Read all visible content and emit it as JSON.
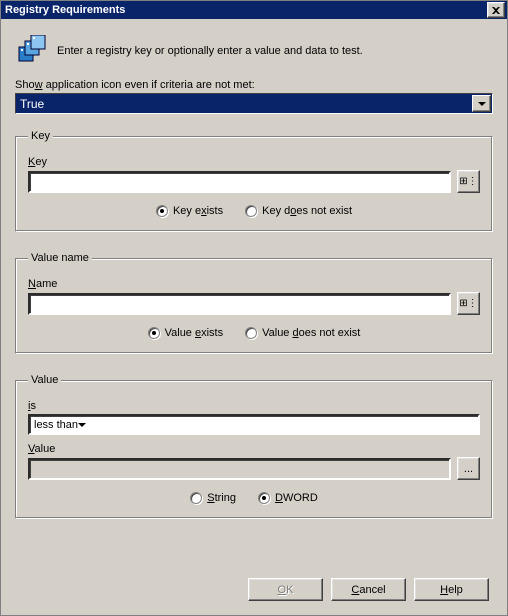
{
  "window": {
    "title": "Registry Requirements"
  },
  "intro": "Enter a registry key or optionally enter a value and data to test.",
  "show_icon_label_pre": "Sho",
  "show_icon_label_u": "w",
  "show_icon_label_post": " application icon even if criteria are not met:",
  "show_icon_value": "True",
  "key_group": {
    "legend": "Key",
    "label_u": "K",
    "label_post": "ey",
    "value": "",
    "radio_exists_pre": "Key e",
    "radio_exists_u": "x",
    "radio_exists_post": "ists",
    "radio_notexists_pre": "Key d",
    "radio_notexists_u": "o",
    "radio_notexists_post": "es not exist",
    "exists_checked": true
  },
  "value_name_group": {
    "legend": "Value name",
    "label_u": "N",
    "label_post": "ame",
    "value": "",
    "radio_exists_pre": "Value ",
    "radio_exists_u": "e",
    "radio_exists_post": "xists",
    "radio_notexists_pre": "Value ",
    "radio_notexists_u": "d",
    "radio_notexists_post": "oes not exist",
    "exists_checked": true
  },
  "value_group": {
    "legend": "Value",
    "is_label": "is",
    "is_label_u": "i",
    "is_label_post": "s",
    "comparison": "less than",
    "value_label_u": "V",
    "value_label_post": "alue",
    "value": "",
    "value_disabled": true,
    "browse_label": "...",
    "radio_string_u": "S",
    "radio_string_post": "tring",
    "radio_dword_u": "D",
    "radio_dword_post": "WORD",
    "dword_checked": true
  },
  "buttons": {
    "ok_u": "O",
    "ok_post": "K",
    "cancel_u": "C",
    "cancel_post": "ancel",
    "help_u": "H",
    "help_post": "elp"
  },
  "icons": {
    "tree_glyph": "⊞⋮"
  }
}
